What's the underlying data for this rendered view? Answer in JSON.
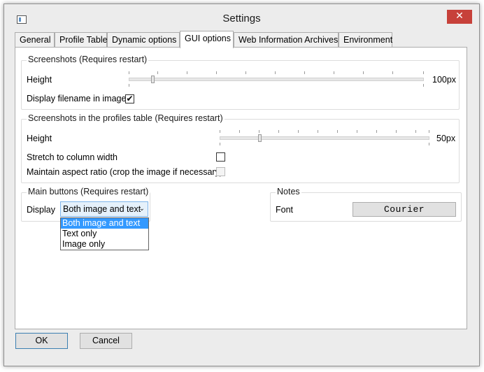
{
  "window": {
    "title": "Settings"
  },
  "tabs": [
    {
      "label": "General"
    },
    {
      "label": "Profile Table"
    },
    {
      "label": "Dynamic options"
    },
    {
      "label": "GUI options"
    },
    {
      "label": "Web Information Archives"
    },
    {
      "label": "Environment"
    }
  ],
  "active_tab": "GUI options",
  "screenshots": {
    "title": "Screenshots (Requires restart)",
    "height_label": "Height",
    "height_value": "100px",
    "height_level": 0.08,
    "display_filename_label": "Display filename in image",
    "display_filename_checked": "✔"
  },
  "profiles_screenshots": {
    "title": "Screenshots in the profiles table (Requires restart)",
    "height_label": "Height",
    "height_value": "50px",
    "height_level": 0.19,
    "stretch_label": "Stretch to column width",
    "aspect_label": "Maintain aspect ratio (crop the image if necessary)"
  },
  "main_buttons": {
    "title": "Main buttons (Requires restart)",
    "display_label": "Display",
    "selected": "Both image and text",
    "options": [
      "Both image and text",
      "Text only",
      "Image only"
    ]
  },
  "notes": {
    "title": "Notes",
    "font_label": "Font",
    "font_button": "Courier"
  },
  "footer": {
    "ok_label": "OK",
    "cancel_label": "Cancel"
  },
  "icons": {
    "close": "close-icon",
    "app": "app-icon",
    "dropdown": "chevron-down-icon",
    "check": "checkmark-icon"
  }
}
